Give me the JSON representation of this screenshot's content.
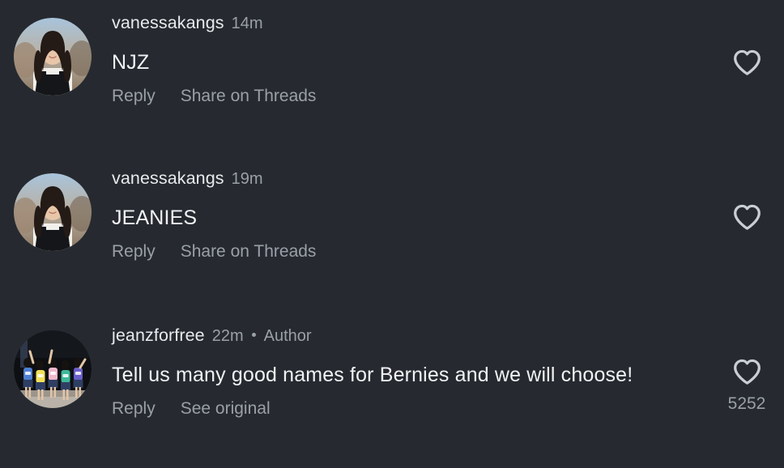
{
  "theme": {
    "background": "#262a30",
    "primary_text": "#f0f2f4",
    "secondary_text": "#9aa0a7",
    "username_text": "#e8eaec",
    "heart_stroke": "#c9ced4"
  },
  "screen": {
    "name": "instagram-comments",
    "heart_icon": "heart-outline-icon"
  },
  "comments": [
    {
      "username": "vanessakangs",
      "timestamp": "14m",
      "is_author": false,
      "author_badge": "",
      "separator_dot": "",
      "text": "NJZ",
      "actions": {
        "reply": "Reply",
        "secondary": "Share on Threads"
      },
      "like_count": "",
      "avatar": {
        "name": "avatar-vanessakangs",
        "description": "woman-dark-hair-white-shirt-black-apron",
        "sky": "#a8c4dc",
        "ground": "#8a7560",
        "skin": "#e8c6a8",
        "hair": "#241a16",
        "shirt": "#f2f0ec",
        "apron": "#15161a"
      }
    },
    {
      "username": "vanessakangs",
      "timestamp": "19m",
      "is_author": false,
      "author_badge": "",
      "separator_dot": "",
      "text": "JEANIES",
      "actions": {
        "reply": "Reply",
        "secondary": "Share on Threads"
      },
      "like_count": "",
      "avatar": {
        "name": "avatar-vanessakangs",
        "description": "woman-dark-hair-white-shirt-black-apron",
        "sky": "#a8c4dc",
        "ground": "#8a7560",
        "skin": "#e8c6a8",
        "hair": "#241a16",
        "shirt": "#f2f0ec",
        "apron": "#15161a"
      }
    },
    {
      "username": "jeanzforfree",
      "timestamp": "22m",
      "is_author": true,
      "author_badge": "Author",
      "separator_dot": "•",
      "text": "Tell us many good names for Bernies and we will choose!",
      "actions": {
        "reply": "Reply",
        "secondary": "See original"
      },
      "like_count": "5252",
      "avatar": {
        "name": "avatar-jeanzforfree",
        "description": "group-of-people-colorful-jerseys-dark-stage",
        "sky": "#0d0f12",
        "ground": "#b9b2a8",
        "skin": "#e2c4a6",
        "hair": "#16120f",
        "shirt": "#6f8fd6",
        "apron": "#2b64b8"
      }
    }
  ]
}
